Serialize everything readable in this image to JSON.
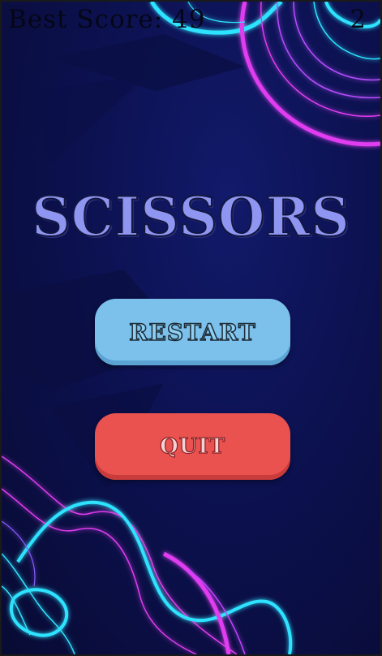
{
  "header": {
    "best_score": "Best Score: 49",
    "current_score": "2"
  },
  "menu": {
    "title": "SCISSORS",
    "restart_label": "RESTART",
    "quit_label": "QUIT"
  },
  "colors": {
    "background": "#0c1150",
    "neon_cyan": "#2fe3ff",
    "neon_magenta": "#e03cf0",
    "title": "#8f96f2",
    "restart_button": "#7cc0ec",
    "quit_button": "#e9524f"
  }
}
